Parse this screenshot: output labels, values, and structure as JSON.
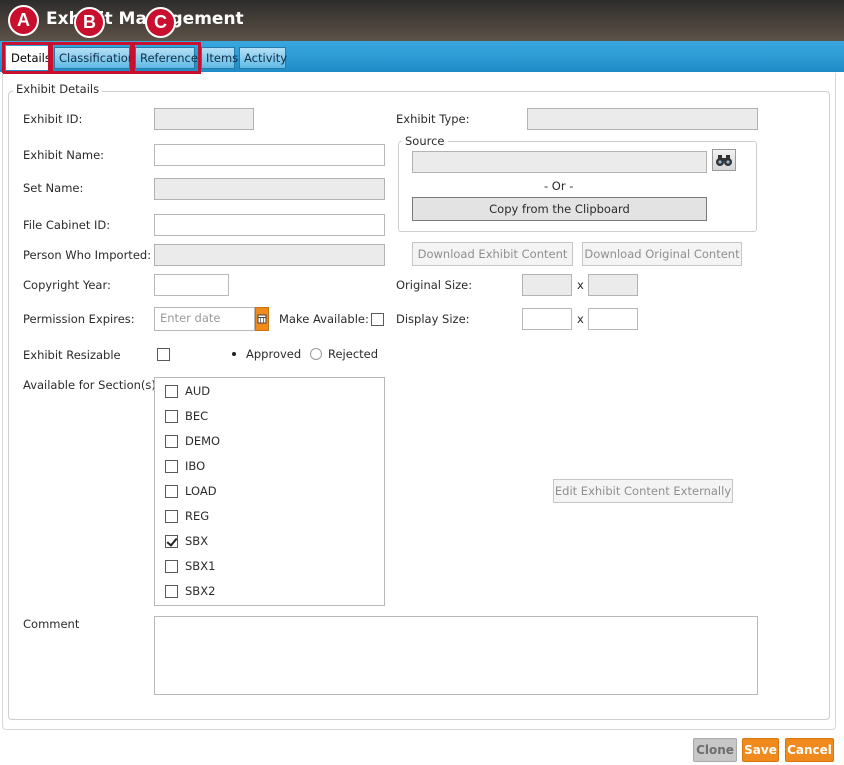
{
  "window": {
    "title": "Exhibit Management"
  },
  "badges": {
    "a": "A",
    "b": "B",
    "c": "C"
  },
  "tabs": [
    {
      "label": "Details"
    },
    {
      "label": "Classification"
    },
    {
      "label": "Reference"
    },
    {
      "label": "Items"
    },
    {
      "label": "Activity"
    }
  ],
  "form": {
    "group_title": "Exhibit Details",
    "exhibit_id_label": "Exhibit ID:",
    "exhibit_id_value": "",
    "exhibit_name_label": "Exhibit Name:",
    "exhibit_name_value": "",
    "set_name_label": "Set Name:",
    "set_name_value": "",
    "file_cabinet_label": "File Cabinet ID:",
    "file_cabinet_value": "",
    "person_imported_label": "Person Who Imported:",
    "person_imported_value": "",
    "copyright_year_label": "Copyright Year:",
    "copyright_year_value": "",
    "permission_expires_label": "Permission Expires:",
    "permission_expires_placeholder": "Enter date",
    "make_available_label": "Make Available:",
    "exhibit_resizable_label": "Exhibit Resizable",
    "approved_label": "Approved",
    "rejected_label": "Rejected",
    "sections_label": "Available for Section(s)",
    "sections": [
      {
        "label": "AUD",
        "checked": false
      },
      {
        "label": "BEC",
        "checked": false
      },
      {
        "label": "DEMO",
        "checked": false
      },
      {
        "label": "IBO",
        "checked": false
      },
      {
        "label": "LOAD",
        "checked": false
      },
      {
        "label": "REG",
        "checked": false
      },
      {
        "label": "SBX",
        "checked": true
      },
      {
        "label": "SBX1",
        "checked": false
      },
      {
        "label": "SBX2",
        "checked": false
      }
    ],
    "comment_label": "Comment",
    "comment_value": "",
    "exhibit_type_label": "Exhibit Type:",
    "exhibit_type_value": "",
    "source_title": "Source",
    "source_value": "",
    "or_text": "- Or -",
    "copy_clipboard_label": "Copy from the Clipboard",
    "download_exhibit_label": "Download Exhibit Content",
    "download_original_label": "Download Original Content",
    "original_size_label": "Original Size:",
    "display_size_label": "Display Size:",
    "x_sep": "x",
    "edit_external_label": "Edit Exhibit Content Externally"
  },
  "footer": {
    "clone_label": "Clone",
    "save_label": "Save",
    "cancel_label": "Cancel"
  },
  "colors": {
    "accent_blue": "#1f8cc8",
    "highlight_red": "#c8102e",
    "save_orange": "#f08a1c",
    "clone_gray": "#b9b9b9"
  }
}
